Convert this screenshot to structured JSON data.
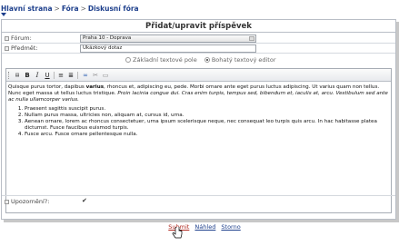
{
  "breadcrumb": {
    "items": [
      "Hlavní strana",
      "Fóra",
      "Diskusní fóra"
    ],
    "separator": ">"
  },
  "page_title": "Přidat/upravit příspěvek",
  "form": {
    "forum_label": "Fórum:",
    "forum_value": "Praha 10 - Doprava",
    "subject_label": "Předmět:",
    "subject_value": "Ukázkový dotaz",
    "editor_modes": {
      "basic": "Základní textové pole",
      "rich": "Bohatý textový editor",
      "selected": "rich"
    },
    "notify_label": "Upozornění?:",
    "notify_checked": true
  },
  "toolbar": {
    "bold": "B",
    "italic": "I",
    "underline": "U",
    "ordered_list": "≡",
    "unordered_list": "≣",
    "link": "∞",
    "unlink": "✂",
    "image": "▭"
  },
  "content": {
    "p_start": "Quisque purus tortor, dapibus ",
    "p_bold": "varius",
    "p_mid": ", rhoncus et, adipiscing eu, pede. Morbi ornare ante eget purus luctus adipiscing. Ut varius quam non tellus. Nunc eget massa ut tellus luctus tristique. ",
    "p_italic": "Proin lacinia congue dui. Cras enim turpis, tempus sed, bibendum et, iaculis at, arcu. Vestibulum sed ante ac nulla ullamcorper varius.",
    "list": [
      "Praesent sagittis suscipit purus.",
      "Nullam purus massa, ultricies non, aliquam at, cursus id, urna.",
      "Aenean ornare, lorem ac rhoncus consectetuer, urna ipsum scelerisque neque, nec consequat leo turpis quis arcu. In hac habitasse platea dictumst. Fusce faucibus euismod turpis.",
      "Fusce arcu. Fusce ornare pellentesque nulla."
    ]
  },
  "actions": {
    "submit": "Submit",
    "preview": "Náhled",
    "cancel": "Storno"
  }
}
